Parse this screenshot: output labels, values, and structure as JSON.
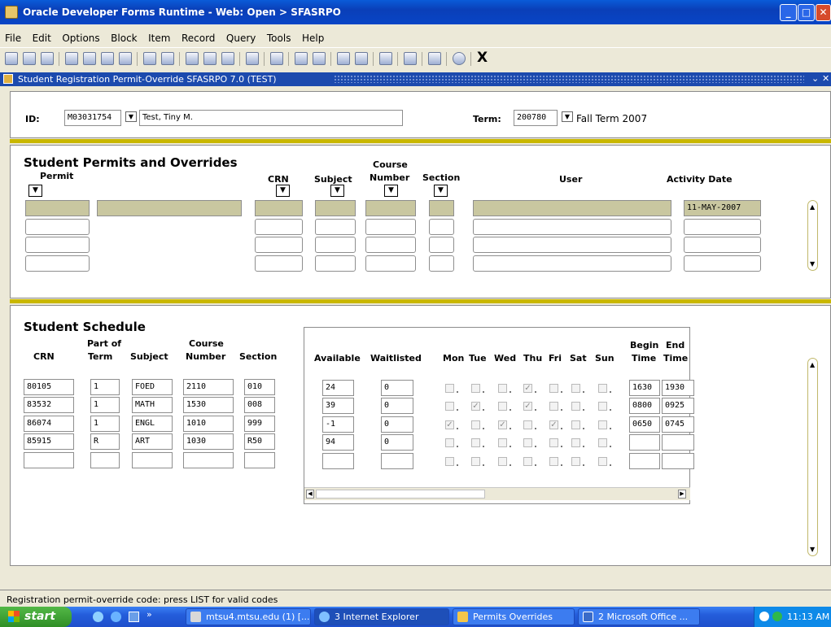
{
  "window": {
    "title": "Oracle Developer Forms Runtime - Web:  Open > SFASRPO"
  },
  "menu": [
    "File",
    "Edit",
    "Options",
    "Block",
    "Item",
    "Record",
    "Query",
    "Tools",
    "Help"
  ],
  "toolbar": {
    "exit_label": "X"
  },
  "form": {
    "caption": "Student Registration Permit-Override  SFASRPO  7.0  (TEST)"
  },
  "key_block": {
    "id_label": "ID:",
    "id_value": "M03031754",
    "name_value": "Test, Tiny M.",
    "term_label": "Term:",
    "term_value": "200780",
    "term_desc": "Fall Term 2007"
  },
  "permits": {
    "title": "Student Permits and Overrides",
    "headers": {
      "permit": "Permit",
      "crn": "CRN",
      "subject": "Subject",
      "course_number_1": "Course",
      "course_number_2": "Number",
      "section": "Section",
      "user": "User",
      "activity_date": "Activity Date"
    },
    "rows": [
      {
        "permit": "",
        "desc": "",
        "crn": "",
        "subject": "",
        "course": "",
        "section": "",
        "user": "",
        "date": "11-MAY-2007"
      },
      {
        "permit": "",
        "desc": "",
        "crn": "",
        "subject": "",
        "course": "",
        "section": "",
        "user": "",
        "date": ""
      },
      {
        "permit": "",
        "desc": "",
        "crn": "",
        "subject": "",
        "course": "",
        "section": "",
        "user": "",
        "date": ""
      },
      {
        "permit": "",
        "desc": "",
        "crn": "",
        "subject": "",
        "course": "",
        "section": "",
        "user": "",
        "date": ""
      }
    ]
  },
  "schedule": {
    "title": "Student Schedule",
    "headers": {
      "crn": "CRN",
      "part_of_term_1": "Part of",
      "part_of_term_2": "Term",
      "subject": "Subject",
      "course_1": "Course",
      "course_2": "Number",
      "section": "Section",
      "available": "Available",
      "waitlisted": "Waitlisted",
      "days": [
        "Mon",
        "Tue",
        "Wed",
        "Thu",
        "Fri",
        "Sat",
        "Sun"
      ],
      "begin_1": "Begin",
      "begin_2": "Time",
      "end_1": "End",
      "end_2": "Time"
    },
    "rows": [
      {
        "crn": "80105",
        "pot": "1",
        "subj": "FOED",
        "crse": "2110",
        "sec": "010",
        "avail": "24",
        "wait": "0",
        "days": [
          false,
          false,
          false,
          true,
          false,
          false,
          false
        ],
        "begin": "1630",
        "end": "1930"
      },
      {
        "crn": "83532",
        "pot": "1",
        "subj": "MATH",
        "crse": "1530",
        "sec": "008",
        "avail": "39",
        "wait": "0",
        "days": [
          false,
          true,
          false,
          true,
          false,
          false,
          false
        ],
        "begin": "0800",
        "end": "0925"
      },
      {
        "crn": "86074",
        "pot": "1",
        "subj": "ENGL",
        "crse": "1010",
        "sec": "999",
        "avail": "-1",
        "wait": "0",
        "days": [
          true,
          false,
          true,
          false,
          true,
          false,
          false
        ],
        "begin": "0650",
        "end": "0745"
      },
      {
        "crn": "85915",
        "pot": "R",
        "subj": "ART",
        "crse": "1030",
        "sec": "R50",
        "avail": "94",
        "wait": "0",
        "days": [
          false,
          false,
          false,
          false,
          false,
          false,
          false
        ],
        "begin": "",
        "end": ""
      },
      {
        "crn": "",
        "pot": "",
        "subj": "",
        "crse": "",
        "sec": "",
        "avail": "",
        "wait": "",
        "days": [
          false,
          false,
          false,
          false,
          false,
          false,
          false
        ],
        "begin": "",
        "end": ""
      }
    ]
  },
  "status": {
    "message": "Registration permit-override code: press LIST for valid codes"
  },
  "taskbar": {
    "start": "start",
    "tasks": [
      "mtsu4.mtsu.edu (1) [...",
      "3 Internet Explorer",
      "Permits Overrides",
      "2 Microsoft Office ..."
    ],
    "clock": "11:13 AM"
  },
  "colors": {
    "title_bar": "#0A50CF",
    "form_caption": "#1C4AAE",
    "current_record": "#C9C7A0",
    "divider": "#C9B700"
  }
}
